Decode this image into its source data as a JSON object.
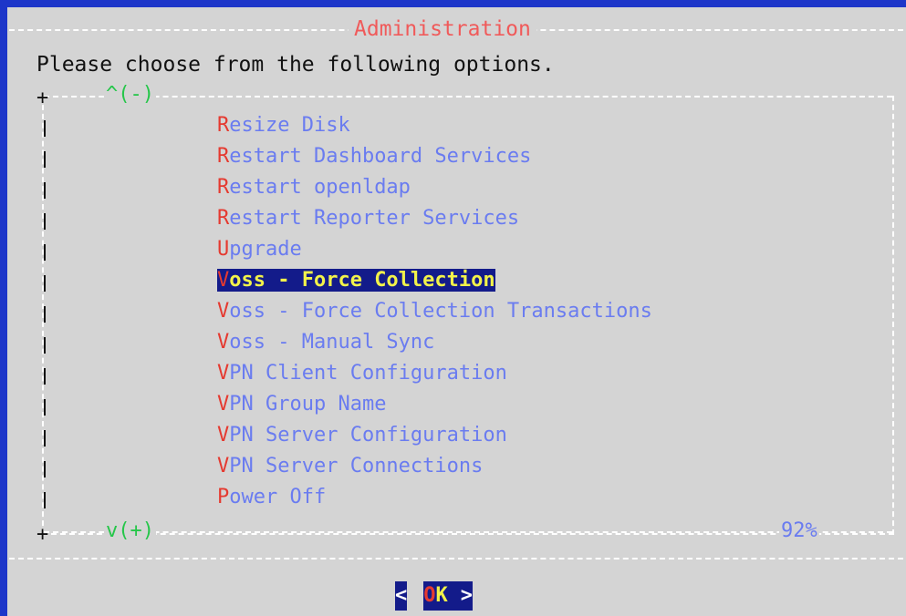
{
  "dialog": {
    "title": "Administration",
    "prompt": "Please choose from the following options.",
    "scroll_up": "^(-)",
    "scroll_down": "v(+)",
    "scroll_percent": "92%"
  },
  "menu": {
    "items": [
      {
        "hot": "R",
        "rest": "esize Disk"
      },
      {
        "hot": "R",
        "rest": "estart Dashboard Services"
      },
      {
        "hot": "R",
        "rest": "estart openldap"
      },
      {
        "hot": "R",
        "rest": "estart Reporter Services"
      },
      {
        "hot": "U",
        "rest": "pgrade"
      },
      {
        "hot": "V",
        "rest": "oss - Force Collection",
        "selected": true
      },
      {
        "hot": "V",
        "rest": "oss - Force Collection Transactions"
      },
      {
        "hot": "V",
        "rest": "oss - Manual Sync"
      },
      {
        "hot": "V",
        "rest": "PN Client Configuration"
      },
      {
        "hot": "V",
        "rest": "PN Group Name"
      },
      {
        "hot": "V",
        "rest": "PN Server Configuration"
      },
      {
        "hot": "V",
        "rest": "PN Server Connections"
      },
      {
        "hot": "P",
        "rest": "ower Off"
      }
    ]
  },
  "buttons": {
    "ok": {
      "left": "<",
      "hot": "O",
      "rest": "K",
      "right": ">"
    }
  },
  "colors": {
    "background": "#d4d4d4",
    "frame_blue": "#1d36c9",
    "title_red": "#f05a5a",
    "item_text": "#6a7cf0",
    "hotkey_red": "#e53a30",
    "selection_bg": "#131b8a",
    "selection_text": "#f2f24a",
    "scroll_green": "#26c64a"
  }
}
